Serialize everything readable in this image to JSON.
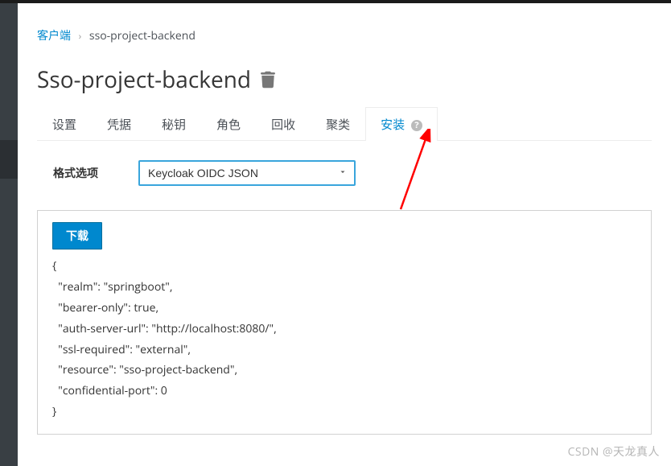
{
  "breadcrumb": {
    "root": "客户端",
    "current": "sso-project-backend"
  },
  "page": {
    "title": "Sso-project-backend"
  },
  "tabs": {
    "items": [
      {
        "label": "设置"
      },
      {
        "label": "凭据"
      },
      {
        "label": "秘钥"
      },
      {
        "label": "角色"
      },
      {
        "label": "回收"
      },
      {
        "label": "聚类"
      },
      {
        "label": "安装"
      }
    ],
    "activeIndex": 6
  },
  "form": {
    "format_label": "格式选项",
    "format_value": "Keycloak OIDC JSON"
  },
  "actions": {
    "download": "下载"
  },
  "code": "{\n  \"realm\": \"springboot\",\n  \"bearer-only\": true,\n  \"auth-server-url\": \"http://localhost:8080/\",\n  \"ssl-required\": \"external\",\n  \"resource\": \"sso-project-backend\",\n  \"confidential-port\": 0\n}",
  "watermark": "CSDN @天龙真人"
}
